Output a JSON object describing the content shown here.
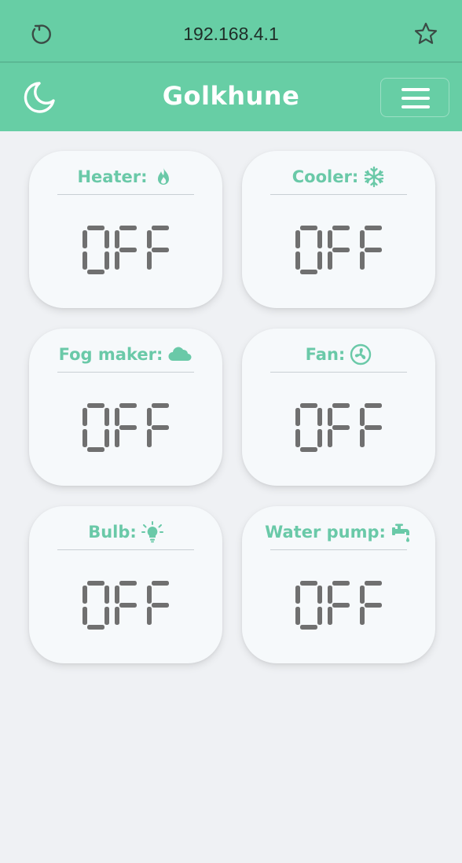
{
  "browser": {
    "url": "192.168.4.1"
  },
  "header": {
    "title": "Golkhune"
  },
  "devices": [
    {
      "label": "Heater:",
      "icon": "fire-icon",
      "state": "OFF"
    },
    {
      "label": "Cooler:",
      "icon": "snowflake-icon",
      "state": "OFF"
    },
    {
      "label": "Fog maker:",
      "icon": "cloud-icon",
      "state": "OFF"
    },
    {
      "label": "Fan:",
      "icon": "fan-icon",
      "state": "OFF"
    },
    {
      "label": "Bulb:",
      "icon": "lightbulb-icon",
      "state": "OFF"
    },
    {
      "label": "Water pump:",
      "icon": "faucet-icon",
      "state": "OFF"
    }
  ],
  "colors": {
    "accent": "#67cea5",
    "label": "#6ac9a8",
    "lcd": "#707070"
  }
}
